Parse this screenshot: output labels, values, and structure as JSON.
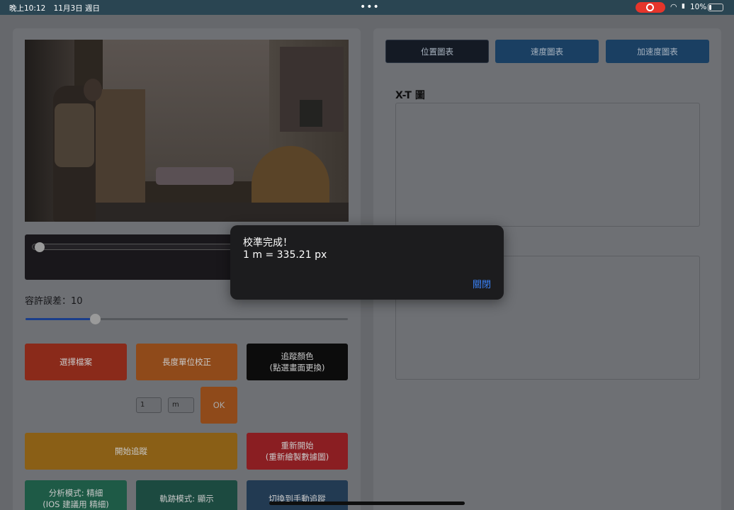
{
  "status_bar": {
    "time": "晚上10:12",
    "date": "11月3日 週日",
    "battery": "10%"
  },
  "tolerance": {
    "label": "容許誤差：10",
    "value": 10
  },
  "buttons": {
    "select_file": "選擇檔案",
    "calibrate": "長度單位校正",
    "track_color_line1": "追蹤顏色",
    "track_color_line2": "(點選畫面更換)",
    "ok": "OK",
    "start_tracking": "開始追蹤",
    "restart_line1": "重新開始",
    "restart_line2": "(重新繪製數據圖)",
    "analysis_line1": "分析模式: 精細",
    "analysis_line2": "(IOS 建議用 精細)",
    "trail_mode": "軌跡模式: 顯示",
    "manual_track": "切換到手動追蹤"
  },
  "calibration_inputs": {
    "length_value": "1",
    "unit_value": "m"
  },
  "chart_tabs": [
    "位置圖表",
    "速度圖表",
    "加速度圖表"
  ],
  "active_tab": "位置圖表",
  "chart_title": "X-T 圖",
  "dialog": {
    "title": "校準完成！",
    "message": "1 m = 335.21 px",
    "close": "關閉"
  },
  "colors": {
    "dialog_bg": "#1c1c1e",
    "dialog_link": "#3a82f7",
    "recording": "#e5352b"
  }
}
